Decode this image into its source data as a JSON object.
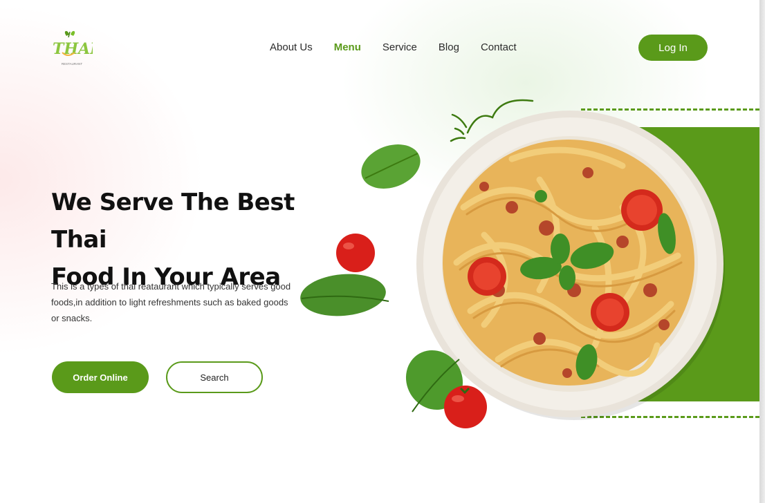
{
  "brand": {
    "logo_text": "THAI",
    "logo_subtext": "RESTAURANT",
    "primary_color": "#5a9a1a"
  },
  "nav": {
    "items": [
      {
        "label": "About Us",
        "active": false
      },
      {
        "label": "Menu",
        "active": true
      },
      {
        "label": "Service",
        "active": false
      },
      {
        "label": "Blog",
        "active": false
      },
      {
        "label": "Contact",
        "active": false
      }
    ]
  },
  "header": {
    "login_label": "Log In"
  },
  "hero": {
    "title_line1": "We Serve The Best Thai",
    "title_line2": "Food In Your Area",
    "description": "This is a types of thai reataurant which typically serves good foods,in addition to light refreshments such as baked goods or snacks.",
    "order_button": "Order Online",
    "search_button": "Search"
  },
  "visuals": {
    "dish": "pasta-bowl-icon",
    "leaf": "basil-leaf-icon",
    "tomato": "tomato-icon",
    "doodle": "cloud-doodle-icon"
  }
}
